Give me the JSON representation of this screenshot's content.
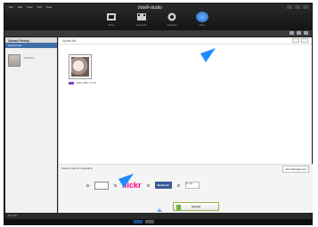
{
  "app": {
    "brand": "Intelli-studio",
    "menu": [
      "File",
      "Edit",
      "View",
      "Tool",
      "Help"
    ]
  },
  "nav": {
    "items": [
      {
        "label": "Library",
        "icon": "library-icon"
      },
      {
        "label": "Movie Edit",
        "icon": "movie-edit-icon"
      },
      {
        "label": "Slideshow",
        "icon": "slideshow-icon"
      },
      {
        "label": "Share",
        "icon": "share-icon",
        "active": true
      }
    ]
  },
  "left_panel": {
    "title": "Upload History",
    "selected_row": "2010.01.15",
    "item_meta": "2010.09.0"
  },
  "main_panel": {
    "title": "Upload list",
    "file": {
      "name": "SAM_0001",
      "size": "71.2K"
    }
  },
  "share": {
    "title": "Select a site for uploading",
    "right_button": "Site Management",
    "services": {
      "flickr": "flickr",
      "facebook": "facebook",
      "email": "E-mail"
    },
    "upload_label": "Upload"
  },
  "bottom": {
    "left_text": "Ver 3.0"
  },
  "colors": {
    "accent": "#1f8bff",
    "facebook": "#3b5998",
    "flickr_blue": "#0063dc",
    "flickr_pink": "#ff0084"
  }
}
